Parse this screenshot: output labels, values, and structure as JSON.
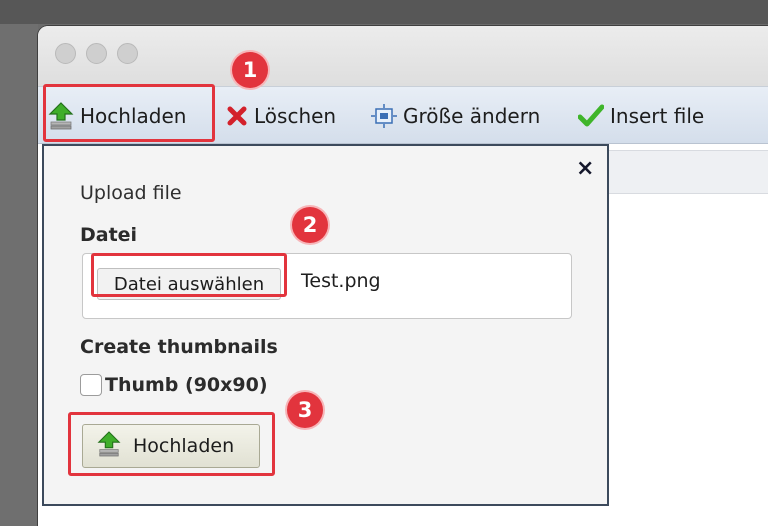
{
  "toolbar": {
    "upload_label": "Hochladen",
    "delete_label": "Löschen",
    "resize_label": "Größe ändern",
    "insert_label": "Insert file"
  },
  "dialog": {
    "close_glyph": "×",
    "title": "Upload file",
    "file_label": "Datei",
    "choose_button_label": "Datei auswählen",
    "selected_file": "Test.png",
    "thumbnails_label": "Create thumbnails",
    "thumb_option_label": "Thumb (90x90)",
    "thumb_checked": false,
    "submit_label": "Hochladen"
  },
  "annotations": {
    "step1": "1",
    "step2": "2",
    "step3": "3"
  },
  "colors": {
    "highlight": "#e2343d",
    "toolbar_bg": "#dce4ef",
    "panel_border": "#3c4a5c"
  },
  "icons": {
    "upload": "upload-arrow-icon",
    "delete": "red-x-icon",
    "resize": "resize-icon",
    "insert": "green-check-icon",
    "close": "close-icon"
  }
}
